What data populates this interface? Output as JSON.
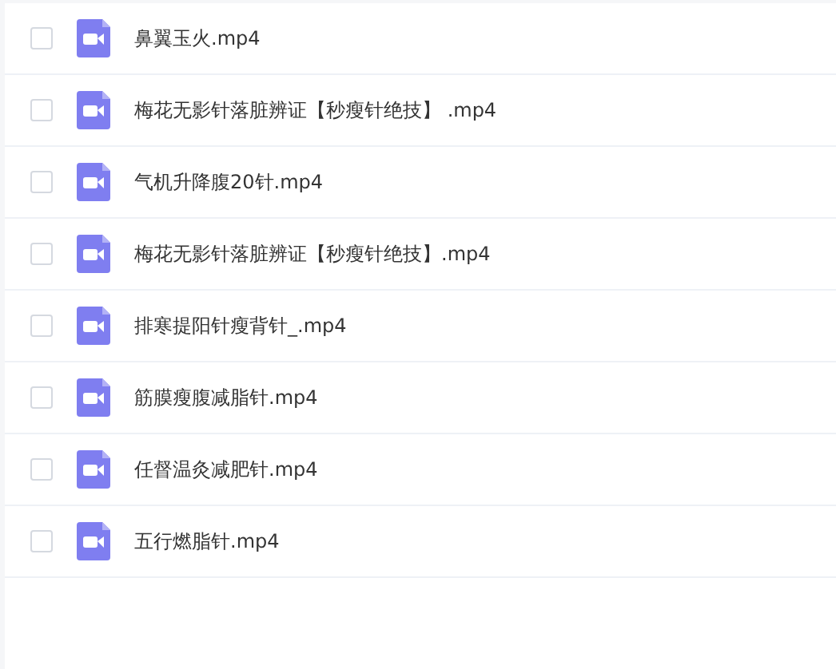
{
  "files": [
    {
      "name": "鼻翼玉火.mp4",
      "checked": false
    },
    {
      "name": "梅花无影针落脏辨证【秒瘦针绝技】 .mp4",
      "checked": false
    },
    {
      "name": "气机升降腹20针.mp4",
      "checked": false
    },
    {
      "name": "梅花无影针落脏辨证【秒瘦针绝技】.mp4",
      "checked": false
    },
    {
      "name": "排寒提阳针瘦背针_.mp4",
      "checked": false
    },
    {
      "name": "筋膜瘦腹减脂针.mp4",
      "checked": false
    },
    {
      "name": "任督温灸减肥针.mp4",
      "checked": false
    },
    {
      "name": "五行燃脂针.mp4",
      "checked": false
    }
  ]
}
